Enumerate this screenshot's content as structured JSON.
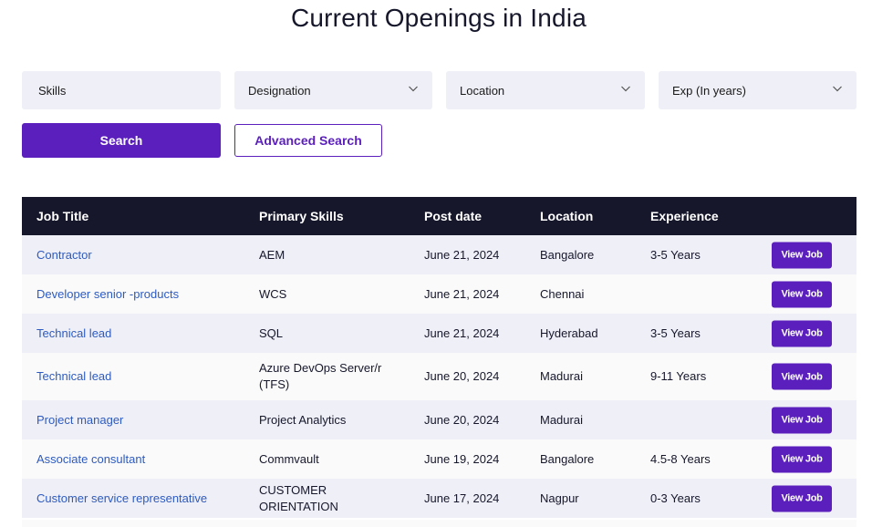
{
  "page": {
    "title": "Current Openings in India"
  },
  "filters": {
    "skills_placeholder": "Skills",
    "designation_label": "Designation",
    "location_label": "Location",
    "experience_label": "Exp (In years)"
  },
  "actions": {
    "search_label": "Search",
    "advanced_search_label": "Advanced Search"
  },
  "table": {
    "headers": [
      "Job Title",
      "Primary Skills",
      "Post date",
      "Location",
      "Experience"
    ],
    "view_label": "View Job",
    "rows": [
      {
        "title": "Contractor",
        "skill": "AEM",
        "date": "June 21, 2024",
        "location": "Bangalore",
        "experience": "3-5 Years"
      },
      {
        "title": "Developer senior -products",
        "skill": "WCS",
        "date": "June 21, 2024",
        "location": "Chennai",
        "experience": ""
      },
      {
        "title": "Technical lead",
        "skill": "SQL",
        "date": "June 21, 2024",
        "location": "Hyderabad",
        "experience": "3-5 Years"
      },
      {
        "title": "Technical lead",
        "skill": "Azure DevOps Server/r (TFS)",
        "date": "June 20, 2024",
        "location": "Madurai",
        "experience": "9-11 Years"
      },
      {
        "title": "Project manager",
        "skill": "Project Analytics",
        "date": "June 20, 2024",
        "location": "Madurai",
        "experience": ""
      },
      {
        "title": "Associate consultant",
        "skill": "Commvault",
        "date": "June 19, 2024",
        "location": "Bangalore",
        "experience": "4.5-8 Years"
      },
      {
        "title": "Customer service representative",
        "skill": "CUSTOMER ORIENTATION",
        "date": "June 17, 2024",
        "location": "Nagpur",
        "experience": "0-3 Years"
      }
    ]
  },
  "colors": {
    "accent": "#5b1fbd",
    "header_bg": "#16172b",
    "link": "#2e5bbf",
    "field_bg": "#efeff7"
  }
}
